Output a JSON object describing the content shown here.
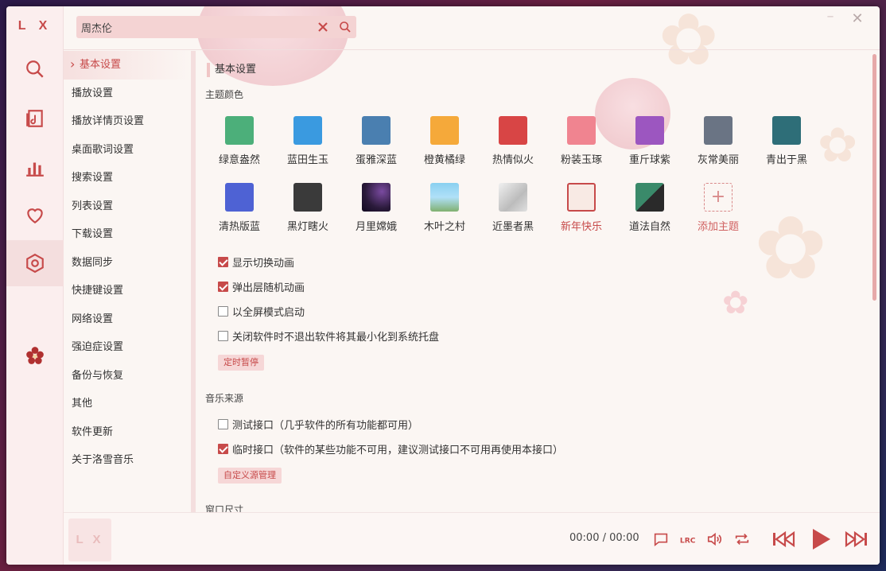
{
  "app": {
    "logo": "L X"
  },
  "search": {
    "value": "周杰伦"
  },
  "colors": {
    "accent": "#c74a4a"
  },
  "sidebar": {
    "items": [
      {
        "label": "基本设置"
      },
      {
        "label": "播放设置"
      },
      {
        "label": "播放详情页设置"
      },
      {
        "label": "桌面歌词设置"
      },
      {
        "label": "搜索设置"
      },
      {
        "label": "列表设置"
      },
      {
        "label": "下载设置"
      },
      {
        "label": "数据同步"
      },
      {
        "label": "快捷键设置"
      },
      {
        "label": "网络设置"
      },
      {
        "label": "强迫症设置"
      },
      {
        "label": "备份与恢复"
      },
      {
        "label": "其他"
      },
      {
        "label": "软件更新"
      },
      {
        "label": "关于洛雪音乐"
      }
    ]
  },
  "main": {
    "section_title": "基本设置",
    "theme_title": "主题颜色",
    "themes": [
      {
        "name": "绿意盎然",
        "color": "#4caf7a"
      },
      {
        "name": "蓝田生玉",
        "color": "#3a9ae0"
      },
      {
        "name": "蛋雅深蓝",
        "color": "#4a7fb0"
      },
      {
        "name": "橙黄橘绿",
        "color": "#f5a93a"
      },
      {
        "name": "热情似火",
        "color": "#d84545"
      },
      {
        "name": "粉装玉琢",
        "color": "#f08490"
      },
      {
        "name": "重斤球紫",
        "color": "#9c56c0"
      },
      {
        "name": "灰常美丽",
        "color": "#6a7484"
      },
      {
        "name": "青出于黑",
        "color": "#2e6e78"
      },
      {
        "name": "清热版蓝",
        "color": "#4e62d4"
      },
      {
        "name": "黑灯瞎火",
        "color": "#3a3a3a"
      },
      {
        "name": "月里嫦娥",
        "color": "#2a1a3a"
      },
      {
        "name": "木叶之村",
        "color": "#7ac0e0"
      },
      {
        "name": "近墨者黑",
        "color": "#c8c8c8"
      },
      {
        "name": "新年快乐",
        "color": "#f8eae4"
      },
      {
        "name": "道法自然",
        "color": "#3a8a6a"
      },
      {
        "name": "添加主题",
        "color": ""
      }
    ],
    "options": [
      {
        "label": "显示切换动画",
        "checked": true
      },
      {
        "label": "弹出层随机动画",
        "checked": true
      },
      {
        "label": "以全屏模式启动",
        "checked": false
      },
      {
        "label": "关闭软件时不退出软件将其最小化到系统托盘",
        "checked": false
      }
    ],
    "timer_button": "定时暂停",
    "source_title": "音乐来源",
    "sources": [
      {
        "label": "测试接口（几乎软件的所有功能都可用）",
        "checked": false
      },
      {
        "label": "临时接口（软件的某些功能不可用，建议测试接口不可用再使用本接口）",
        "checked": true
      }
    ],
    "source_button": "自定义源管理",
    "window_size_title": "窗口尺寸"
  },
  "player": {
    "cover_text": "L X",
    "current_time": "00:00",
    "separator": "/",
    "total_time": "00:00"
  }
}
